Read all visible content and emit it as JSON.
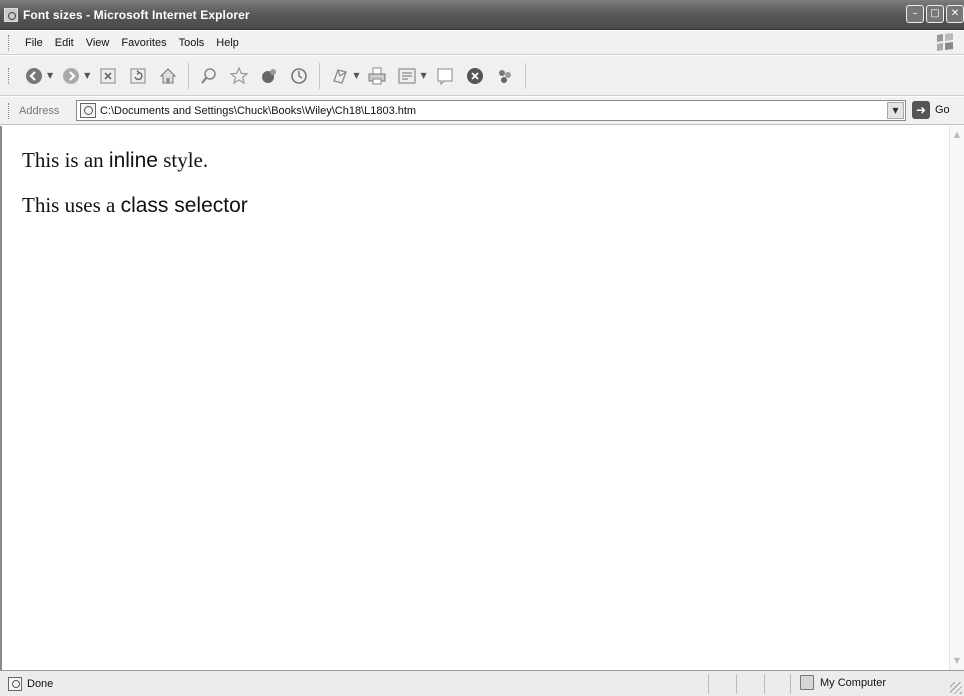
{
  "window": {
    "title": "Font sizes - Microsoft Internet Explorer"
  },
  "menu": {
    "items": [
      "File",
      "Edit",
      "View",
      "Favorites",
      "Tools",
      "Help"
    ]
  },
  "toolbar": {
    "buttons": [
      "back-icon",
      "forward-icon",
      "stop-icon",
      "refresh-icon",
      "home-icon",
      "search-icon",
      "favorites-icon",
      "media-icon",
      "history-icon",
      "mail-icon",
      "print-icon",
      "edit-icon",
      "discuss-icon",
      "messenger-icon",
      "research-icon"
    ]
  },
  "address": {
    "label": "Address",
    "url": "C:\\Documents and Settings\\Chuck\\Books\\Wiley\\Ch18\\L1803.htm",
    "go_label": "Go"
  },
  "content": {
    "para1": {
      "before": "This is an ",
      "styled": "inline",
      "after": " style."
    },
    "para2": {
      "before": "This uses a ",
      "styled": "class selector"
    }
  },
  "status": {
    "text": "Done",
    "zone": "My Computer"
  }
}
